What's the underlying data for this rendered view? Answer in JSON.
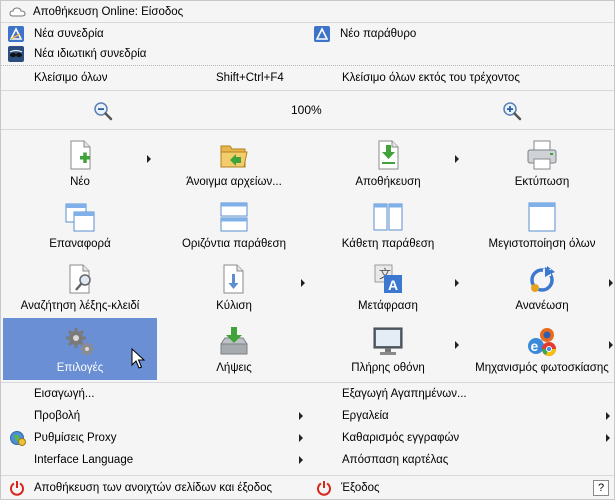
{
  "top": {
    "online_save": "Αποθήκευση Online: Είσοδος",
    "new_session": "Νέα συνεδρία",
    "new_window": "Νέο παράθυρο",
    "new_private_session": "Νέα ιδιωτική συνεδρία"
  },
  "close": {
    "close_all": "Κλείσιμο όλων",
    "shortcut": "Shift+Ctrl+F4",
    "close_others": "Κλείσιμο όλων εκτός του τρέχοντος"
  },
  "zoom": {
    "level": "100%"
  },
  "grid": [
    {
      "label": "Νέο",
      "icon": "new-document-icon"
    },
    {
      "label": "Άνοιγμα αρχείων...",
      "icon": "open-folder-icon"
    },
    {
      "label": "Αποθήκευση",
      "icon": "save-download-icon"
    },
    {
      "label": "Εκτύπωση",
      "icon": "printer-icon"
    },
    {
      "label": "Επαναφορά",
      "icon": "restore-windows-icon"
    },
    {
      "label": "Οριζόντια παράθεση",
      "icon": "tile-horizontal-icon"
    },
    {
      "label": "Κάθετη παράθεση",
      "icon": "tile-vertical-icon"
    },
    {
      "label": "Μεγιστοποίηση όλων",
      "icon": "maximize-all-icon"
    },
    {
      "label": "Αναζήτηση λέξης-κλειδί",
      "icon": "search-keyword-icon"
    },
    {
      "label": "Κύλιση",
      "icon": "scroll-icon"
    },
    {
      "label": "Μετάφραση",
      "icon": "translate-icon"
    },
    {
      "label": "Ανανέωση",
      "icon": "refresh-icon"
    },
    {
      "label": "Επιλογές",
      "icon": "gears-options-icon"
    },
    {
      "label": "Λήψεις",
      "icon": "downloads-icon"
    },
    {
      "label": "Πλήρης οθόνη",
      "icon": "fullscreen-monitor-icon"
    },
    {
      "label": "Μηχανισμός φωτοσκίασης",
      "icon": "rendering-engine-icon"
    }
  ],
  "list": {
    "import": "Εισαγωγή...",
    "export_favorites": "Εξαγωγή Αγαπημένων...",
    "view": "Προβολή",
    "tools": "Εργαλεία",
    "proxy": "Ρυθμίσεις Proxy",
    "clear_records": "Καθαρισμός εγγραφών",
    "interface_language": "Interface Language",
    "detach_tab": "Απόσπαση καρτέλας"
  },
  "bottom": {
    "save_and_exit": "Αποθήκευση των ανοιχτών σελίδων και έξοδος",
    "exit": "Έξοδος",
    "help": "?"
  },
  "colors": {
    "selected": "#6a8fd4",
    "power_red": "#d9261c"
  }
}
